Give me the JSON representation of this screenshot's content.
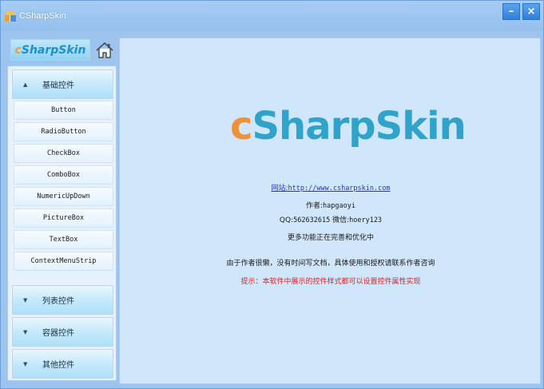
{
  "window": {
    "title": "CSharpSkin",
    "minimize_glyph": "–",
    "close_glyph": "×"
  },
  "sidebar": {
    "logo": {
      "c": "c",
      "rest": "SharpSkin"
    },
    "home_icon": "home-icon",
    "groups": [
      {
        "label": "基础控件",
        "expanded": true,
        "arrow": "▲",
        "items": [
          "Button",
          "RadioButton",
          "CheckBox",
          "ComboBox",
          "NumericUpDown",
          "PictureBox",
          "TextBox",
          "ContextMenuStrip"
        ]
      },
      {
        "label": "列表控件",
        "expanded": false,
        "arrow": "▼"
      },
      {
        "label": "容器控件",
        "expanded": false,
        "arrow": "▼"
      },
      {
        "label": "其他控件",
        "expanded": false,
        "arrow": "▼"
      }
    ]
  },
  "main": {
    "logo": {
      "c": "c",
      "rest": "SharpSkin"
    },
    "website_label": "网站:",
    "website_url": "http://www.csharpskin.com",
    "author_label": "作者:",
    "author_name": "hapgaoyi",
    "qq_label": "QQ:",
    "qq_number": "562632615",
    "wechat_label": "微信:",
    "wechat_id": "hoery123",
    "more_features": "更多功能正在完善和优化中",
    "notice": "由于作者很懒，没有时间写文档，具体使用和授权请联系作者咨询",
    "tip": "提示：本软件中展示的控件样式都可以设置控件属性实现"
  },
  "colors": {
    "logo_c": "#f0913a",
    "logo_text": "#2fa3c9",
    "link": "#2330d8",
    "tip": "#e62020",
    "titlebar": "#9cc4ef",
    "button": "#2f80de"
  }
}
